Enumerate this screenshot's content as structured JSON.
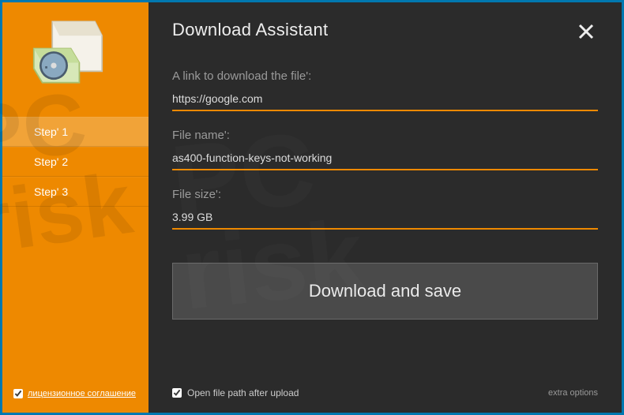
{
  "header": {
    "title": "Download Assistant"
  },
  "sidebar": {
    "steps": [
      {
        "label": "Step' 1",
        "active": true
      },
      {
        "label": "Step' 2",
        "active": false
      },
      {
        "label": "Step' 3",
        "active": false
      }
    ],
    "license_label": "лицензионное соглашение",
    "license_checked": true
  },
  "form": {
    "link_label": "A link to download the file':",
    "link_value": "https://google.com",
    "name_label": "File name':",
    "name_value": "as400-function-keys-not-working",
    "size_label": "File size':",
    "size_value": "3.99 GB"
  },
  "actions": {
    "download_label": "Download and save"
  },
  "footer": {
    "open_path_label": "Open file path after upload",
    "open_path_checked": true,
    "extra_label": "extra options"
  },
  "colors": {
    "accent": "#ee8900",
    "frame": "#0078b0",
    "panel": "#2b2b2b"
  }
}
